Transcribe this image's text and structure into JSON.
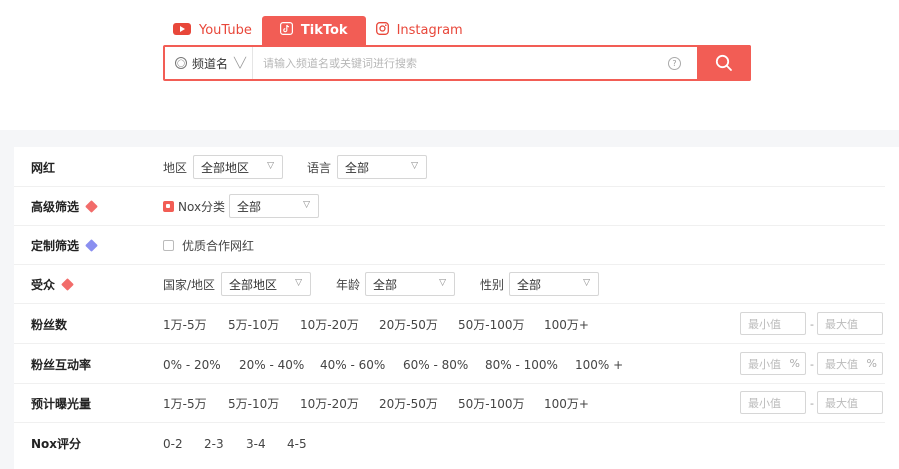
{
  "tabs": [
    {
      "label": "YouTube",
      "icon": "youtube-icon",
      "active": false
    },
    {
      "label": "TikTok",
      "icon": "tiktok-icon",
      "active": true
    },
    {
      "label": "Instagram",
      "icon": "instagram-icon",
      "active": false
    }
  ],
  "search": {
    "type_label": "频道名",
    "placeholder": "请输入频道名或关键词进行搜索"
  },
  "filters": {
    "influencer": {
      "label": "网红",
      "region_label": "地区",
      "region_value": "全部地区",
      "language_label": "语言",
      "language_value": "全部"
    },
    "advanced": {
      "label": "高级筛选",
      "nox_label": "Nox分类",
      "nox_value": "全部"
    },
    "custom": {
      "label": "定制筛选",
      "option": "优质合作网红"
    },
    "audience": {
      "label": "受众",
      "country_label": "国家/地区",
      "country_value": "全部地区",
      "age_label": "年龄",
      "age_value": "全部",
      "gender_label": "性别",
      "gender_value": "全部"
    },
    "followers": {
      "label": "粉丝数",
      "options": [
        "1万-5万",
        "5万-10万",
        "10万-20万",
        "20万-50万",
        "50万-100万",
        "100万+"
      ],
      "min_placeholder": "最小值",
      "max_placeholder": "最大值"
    },
    "engagement": {
      "label": "粉丝互动率",
      "options": [
        "0% - 20%",
        "20% - 40%",
        "40% - 60%",
        "60% - 80%",
        "80% - 100%",
        "100% +"
      ],
      "min_placeholder": "最小值",
      "max_placeholder": "最大值",
      "unit": "%"
    },
    "views": {
      "label": "预计曝光量",
      "options": [
        "1万-5万",
        "5万-10万",
        "10万-20万",
        "20万-50万",
        "50万-100万",
        "100万+"
      ],
      "min_placeholder": "最小值",
      "max_placeholder": "最大值"
    },
    "nox_score": {
      "label": "Nox评分",
      "options": [
        "0-2",
        "2-3",
        "3-4",
        "4-5"
      ]
    }
  },
  "colors": {
    "accent": "#f25d55",
    "youtube": "#e8473a",
    "gem_red": "#f26c6a",
    "gem_purple": "#8a8ff0"
  }
}
